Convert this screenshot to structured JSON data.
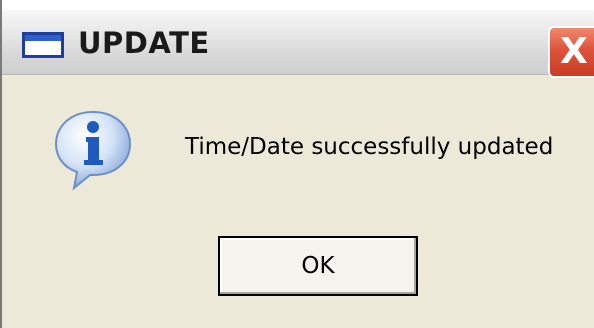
{
  "window": {
    "title": "UPDATE",
    "close_label": "X"
  },
  "icons": {
    "window_icon": "window-icon",
    "message_icon": "information-icon",
    "close_icon": "close-icon"
  },
  "dialog": {
    "message": "Time/Date successfully updated",
    "ok_label": "OK"
  },
  "colors": {
    "dialog_background": "#ece9d8",
    "close_button": "#e0523b",
    "info_icon": "#2b62c4"
  }
}
